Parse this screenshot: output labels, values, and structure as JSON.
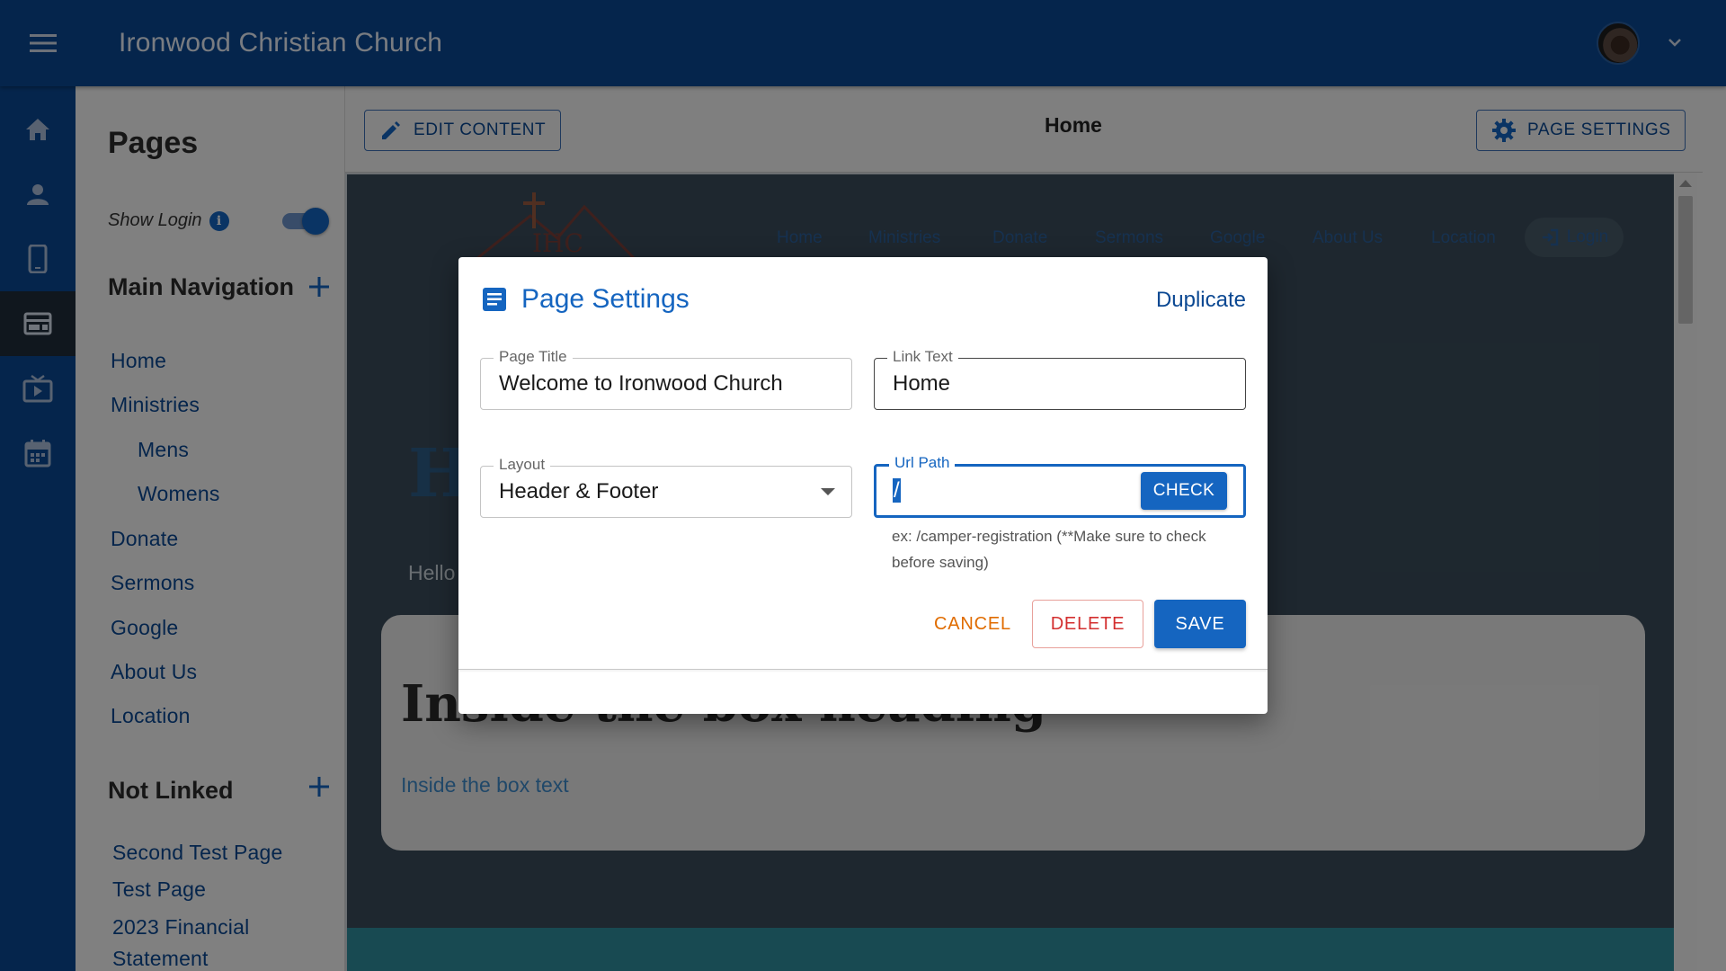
{
  "app": {
    "title": "Ironwood Christian Church"
  },
  "icons": {
    "menu": "menu-icon",
    "avatar": "user-avatar",
    "caret": "chevron-down-icon",
    "rail": [
      "home-icon",
      "person-icon",
      "mobile-icon",
      "web-icon",
      "video-icon",
      "calendar-icon"
    ],
    "active_rail": "web-icon"
  },
  "colors": {
    "primary": "#0b4892",
    "accent": "#1565c0",
    "cancel": "#e06c00",
    "delete": "#d32f2f"
  },
  "sidebar": {
    "title": "Pages",
    "show_login_label": "Show Login",
    "show_login_on": true,
    "main_nav_title": "Main Navigation",
    "main_nav": [
      "Home",
      "Ministries",
      "Mens",
      "Womens",
      "Donate",
      "Sermons",
      "Google",
      "About Us",
      "Location"
    ],
    "not_linked_title": "Not Linked",
    "not_linked": [
      "Second Test Page",
      "Test Page",
      "2023 Financial",
      "Statement"
    ]
  },
  "toolbar": {
    "edit_label": "EDIT CONTENT",
    "page_title": "Home",
    "settings_label": "PAGE SETTINGS"
  },
  "preview": {
    "nav": [
      "Home",
      "Ministries",
      "Donate",
      "Sermons",
      "Google",
      "About Us",
      "Location"
    ],
    "login": "Login",
    "heading": "H",
    "hello": "Hello",
    "box_heading": "Inside the box heading",
    "box_text": "Inside the box text"
  },
  "dialog": {
    "title": "Page Settings",
    "duplicate": "Duplicate",
    "page_title_label": "Page Title",
    "page_title_value": "Welcome to Ironwood Church",
    "link_text_label": "Link Text",
    "link_text_value": "Home",
    "layout_label": "Layout",
    "layout_value": "Header & Footer",
    "url_label": "Url Path",
    "url_value": "/",
    "check": "CHECK",
    "helper": "ex: /camper-registration (**Make sure to check before saving)",
    "cancel": "CANCEL",
    "delete": "DELETE",
    "save": "SAVE"
  }
}
